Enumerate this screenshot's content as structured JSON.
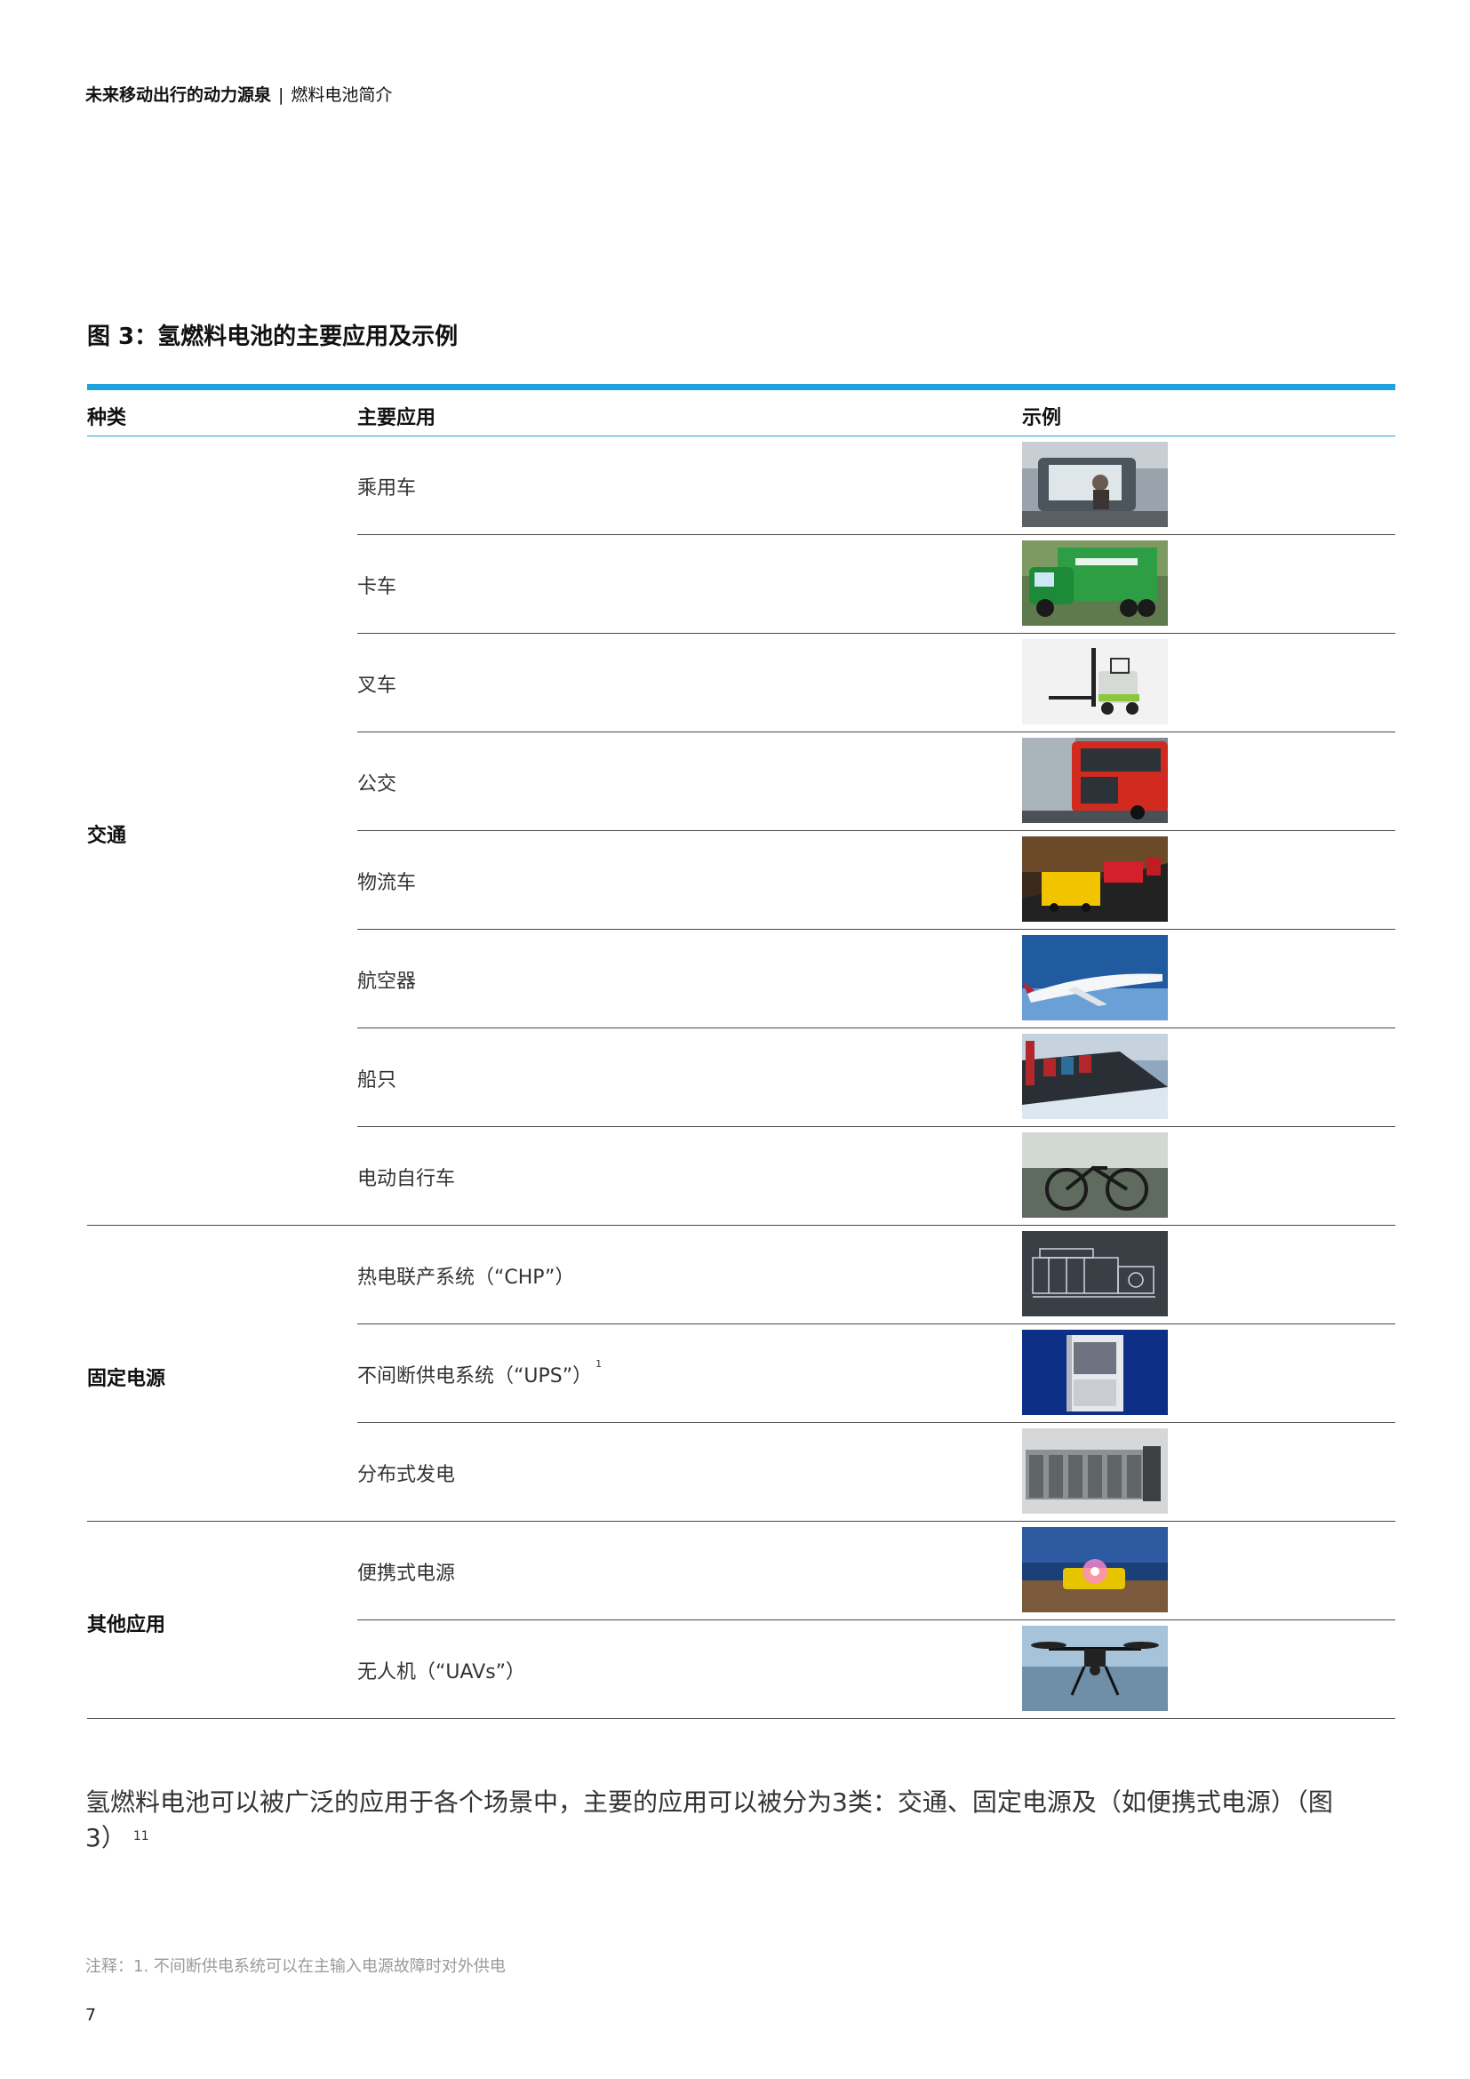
{
  "header": {
    "title": "未来移动出行的动力源泉",
    "separator": "|",
    "subtitle": "燃料电池简介"
  },
  "figure": {
    "title": "图 3：氢燃料电池的主要应用及示例",
    "accent_color": "#1fa3df"
  },
  "table": {
    "headers": {
      "type": "种类",
      "application": "主要应用",
      "example": "示例"
    },
    "groups": [
      {
        "label": "交通",
        "rows": [
          {
            "label": "乘用车",
            "sup": "",
            "image": "passenger-car"
          },
          {
            "label": "卡车",
            "sup": "",
            "image": "truck"
          },
          {
            "label": "叉车",
            "sup": "",
            "image": "forklift"
          },
          {
            "label": "公交",
            "sup": "",
            "image": "bus"
          },
          {
            "label": "物流车",
            "sup": "",
            "image": "logistics-truck"
          },
          {
            "label": "航空器",
            "sup": "",
            "image": "airplane"
          },
          {
            "label": "船只",
            "sup": "",
            "image": "ship"
          },
          {
            "label": "电动自行车",
            "sup": "",
            "image": "e-bike"
          }
        ]
      },
      {
        "label": "固定电源",
        "rows": [
          {
            "label": "热电联产系统（“CHP”）",
            "sup": "",
            "image": "chp-engine"
          },
          {
            "label": "不间断供电系统（“UPS”）",
            "sup": "1",
            "image": "ups-cabinet"
          },
          {
            "label": "分布式发电",
            "sup": "",
            "image": "distributed-generation"
          }
        ]
      },
      {
        "label": "其他应用",
        "rows": [
          {
            "label": "便携式电源",
            "sup": "",
            "image": "portable-power"
          },
          {
            "label": "无人机（“UAVs”）",
            "sup": "",
            "image": "drone"
          }
        ]
      }
    ]
  },
  "body": {
    "text": "氢燃料电池可以被广泛的应用于各个场景中，主要的应用可以被分为3类：交通、固定电源及（如便携式电源）（图3）",
    "sup": "11"
  },
  "footnote": "注释：1. 不间断供电系统可以在主输入电源故障时对外供电",
  "page_number": "7"
}
